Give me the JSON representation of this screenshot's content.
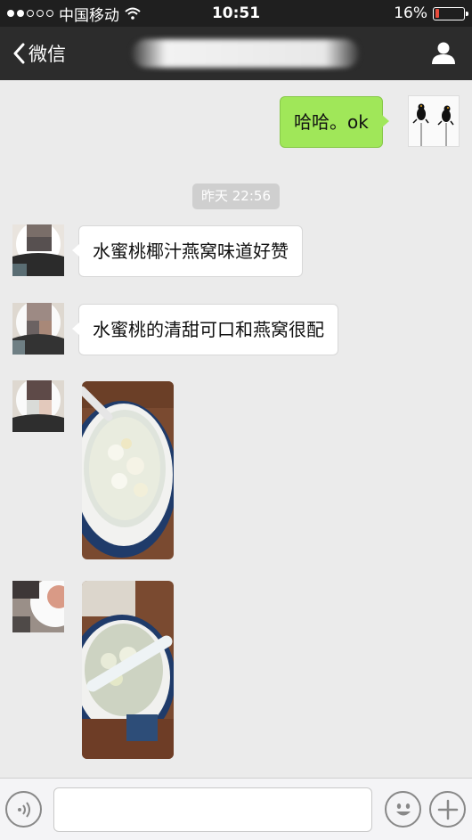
{
  "status_bar": {
    "carrier": "中国移动",
    "time": "10:51",
    "battery": "16%",
    "battery_level": 0.16
  },
  "nav": {
    "back_label": "微信"
  },
  "messages": [
    {
      "dir": "out",
      "text": "哈哈。ok"
    },
    {
      "dir": "in",
      "text": "水蜜桃椰汁燕窝味道好赞"
    },
    {
      "dir": "in",
      "text": "水蜜桃的清甜可口和燕窝很配"
    }
  ],
  "timestamp": "昨天 22:56",
  "colors": {
    "accent_green": "#a0e759",
    "nav_bg": "#2c2c2c",
    "chat_bg": "#ebebeb",
    "battery_low": "#e74c3c"
  },
  "icons": [
    "back-chevron-icon",
    "profile-icon",
    "voice-icon",
    "emoji-icon",
    "plus-icon",
    "wifi-icon"
  ]
}
